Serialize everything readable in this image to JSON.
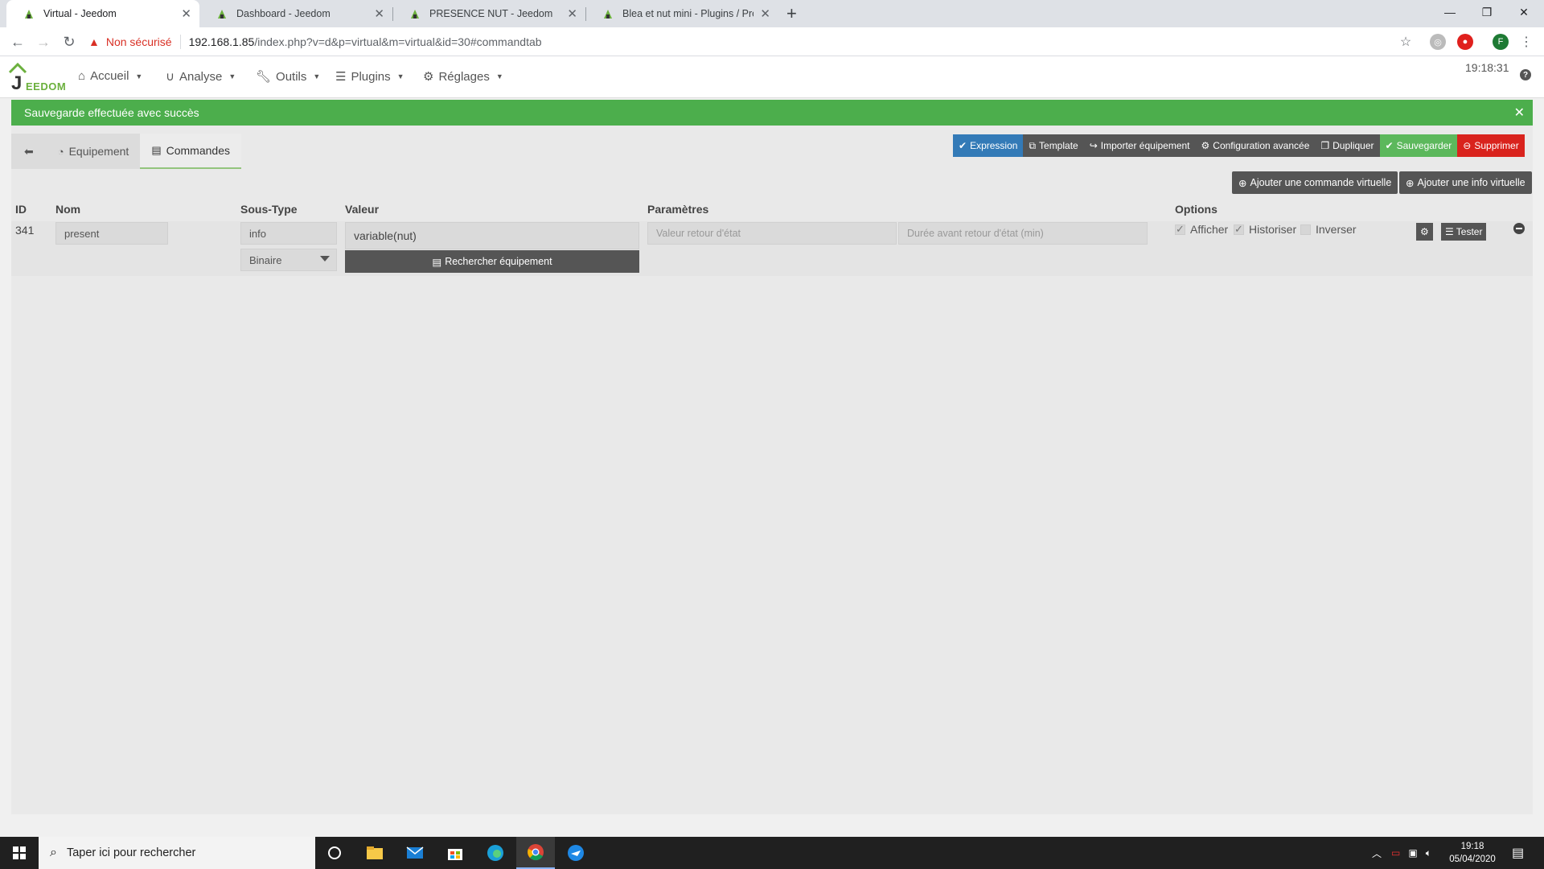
{
  "browser": {
    "tabs": [
      {
        "title": "Virtual - Jeedom",
        "active": true
      },
      {
        "title": "Dashboard - Jeedom",
        "active": false
      },
      {
        "title": "PRESENCE NUT - Jeedom",
        "active": false
      },
      {
        "title": "Blea et nut mini - Plugins / Proto",
        "active": false
      }
    ],
    "security_label": "Non sécurisé",
    "url_host": "192.168.1.85",
    "url_path": "/index.php?v=d&p=virtual&m=virtual&id=30#commandtab",
    "profile_initial": "F"
  },
  "jeedom": {
    "logo_text": "EEDOM",
    "menu": [
      {
        "label": "Accueil",
        "icon": "home-icon"
      },
      {
        "label": "Analyse",
        "icon": "magnet-icon"
      },
      {
        "label": "Outils",
        "icon": "wrench-icon"
      },
      {
        "label": "Plugins",
        "icon": "list-icon"
      },
      {
        "label": "Réglages",
        "icon": "gear-icon"
      }
    ],
    "clock": "19:18:31",
    "alert": "Sauvegarde effectuée avec succès",
    "tabs": [
      {
        "label": "",
        "icon": "back-arrow-icon"
      },
      {
        "label": "Equipement",
        "icon": "tachometer-icon"
      },
      {
        "label": "Commandes",
        "icon": "list-alt-icon",
        "active": true
      }
    ],
    "actions": [
      {
        "label": "Expression",
        "icon": "check-icon",
        "color": "#337ab7"
      },
      {
        "label": "Template",
        "icon": "cubes-icon",
        "color": "#555555"
      },
      {
        "label": "Importer équipement",
        "icon": "share-icon",
        "color": "#555555"
      },
      {
        "label": "Configuration avancée",
        "icon": "cogs-icon",
        "color": "#555555"
      },
      {
        "label": "Dupliquer",
        "icon": "files-icon",
        "color": "#555555"
      },
      {
        "label": "Sauvegarder",
        "icon": "check-circle-icon",
        "color": "#5cb85c"
      },
      {
        "label": "Supprimer",
        "icon": "minus-circle-icon",
        "color": "#d9231d"
      }
    ],
    "add_virtual_command": "Ajouter une commande virtuelle",
    "add_virtual_info": "Ajouter une info virtuelle",
    "table": {
      "headers": {
        "id": "ID",
        "name": "Nom",
        "subtype": "Sous-Type",
        "value": "Valeur",
        "params": "Paramètres",
        "options": "Options"
      },
      "row": {
        "id": "341",
        "name": "present",
        "type": "info",
        "subtype": "Binaire",
        "value": "variable(nut)",
        "search_equipment": "Rechercher équipement",
        "param1_placeholder": "Valeur retour d'état",
        "param2_placeholder": "Durée avant retour d'état (min)",
        "opt_display": "Afficher",
        "opt_display_checked": true,
        "opt_history": "Historiser",
        "opt_history_checked": true,
        "opt_invert": "Inverser",
        "opt_invert_checked": false,
        "test_label": "Tester"
      }
    }
  },
  "taskbar": {
    "search_placeholder": "Taper ici pour rechercher",
    "time": "19:18",
    "date": "05/04/2020"
  }
}
